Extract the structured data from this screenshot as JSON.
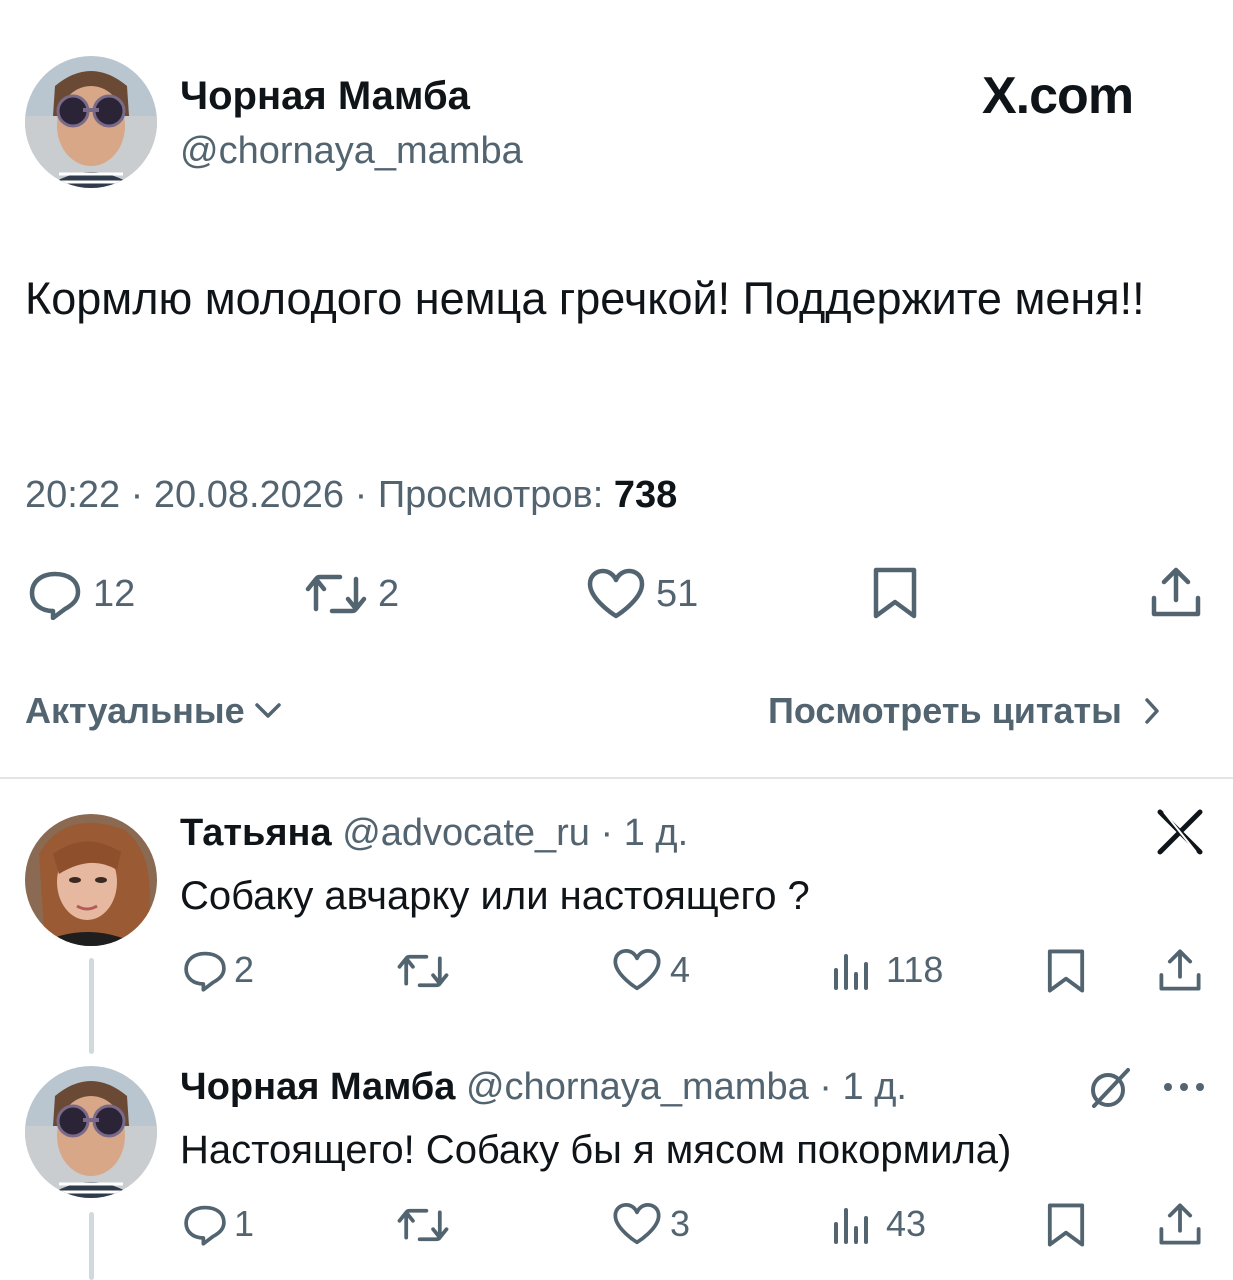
{
  "tweet": {
    "author_name": "Чорная Мамба",
    "author_handle": "@chornaya_mamba",
    "brand": "X.com",
    "text": "Кормлю молодого немца гречкой! Поддержите меня!!",
    "time": "20:22",
    "date": "20.08.2026",
    "views_label": "Просмотров:",
    "views_count": "738",
    "replies": "12",
    "retweets": "2",
    "likes": "51"
  },
  "filters": {
    "sort_label": "Актуальные",
    "quotes_label": "Посмотреть цитаты"
  },
  "replies": [
    {
      "name": "Татьяна",
      "handle": "@advocate_ru",
      "age": "· 1 д.",
      "text": "Собаку авчарку или настоящего ?",
      "replies": "2",
      "likes": "4",
      "views": "118"
    },
    {
      "name": "Чорная Мамба",
      "handle": "@chornaya_mamba",
      "age": "· 1 д.",
      "text": "Настоящего! Собаку бы я мясом покормила)",
      "replies": "1",
      "likes": "3",
      "views": "43"
    }
  ],
  "colors": {
    "text": "#0f1419",
    "secondary": "#536471",
    "divider": "#e1e5e8"
  }
}
